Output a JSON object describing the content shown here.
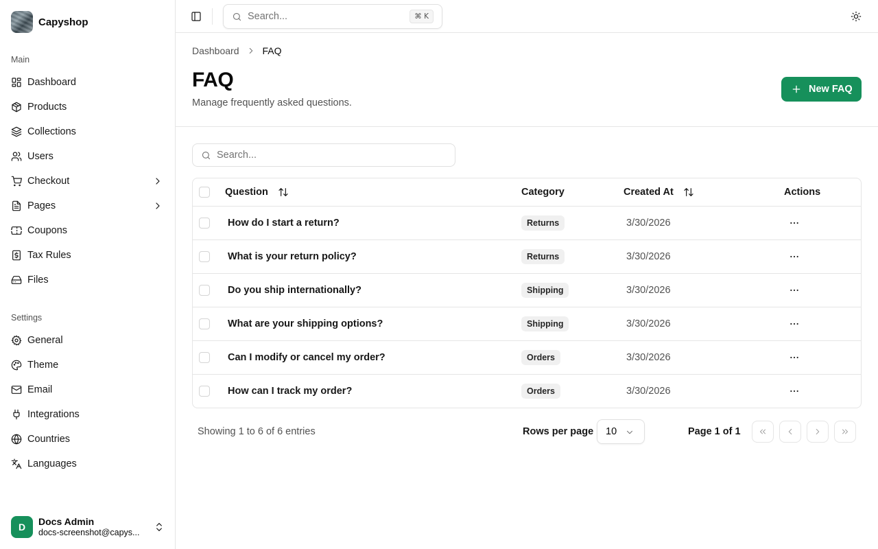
{
  "app": {
    "name": "Capyshop"
  },
  "sidebar": {
    "groups": [
      {
        "label": "Main",
        "items": [
          {
            "label": "Dashboard",
            "icon": "dashboard-icon"
          },
          {
            "label": "Products",
            "icon": "package-icon"
          },
          {
            "label": "Collections",
            "icon": "layers-icon"
          },
          {
            "label": "Users",
            "icon": "users-icon"
          },
          {
            "label": "Checkout",
            "icon": "cart-icon",
            "expandable": true
          },
          {
            "label": "Pages",
            "icon": "file-icon",
            "expandable": true
          },
          {
            "label": "Coupons",
            "icon": "ticket-icon"
          },
          {
            "label": "Tax Rules",
            "icon": "receipt-icon"
          },
          {
            "label": "Files",
            "icon": "drive-icon"
          }
        ]
      },
      {
        "label": "Settings",
        "items": [
          {
            "label": "General",
            "icon": "gear-icon"
          },
          {
            "label": "Theme",
            "icon": "palette-icon"
          },
          {
            "label": "Email",
            "icon": "mail-icon"
          },
          {
            "label": "Integrations",
            "icon": "plug-icon"
          },
          {
            "label": "Countries",
            "icon": "globe-icon"
          },
          {
            "label": "Languages",
            "icon": "translate-icon"
          }
        ]
      }
    ],
    "user": {
      "initial": "D",
      "name": "Docs Admin",
      "email": "docs-screenshot@capys..."
    }
  },
  "topbar": {
    "search": {
      "placeholder": "Search...",
      "shortcut": "⌘ K"
    }
  },
  "breadcrumb": {
    "parent": "Dashboard",
    "current": "FAQ"
  },
  "page": {
    "title": "FAQ",
    "subtitle": "Manage frequently asked questions.",
    "new_button": "New FAQ"
  },
  "table": {
    "search_placeholder": "Search...",
    "columns": {
      "question": "Question",
      "category": "Category",
      "created_at": "Created At",
      "actions": "Actions"
    },
    "rows": [
      {
        "question": "How do I start a return?",
        "category": "Returns",
        "created_at": "3/30/2026"
      },
      {
        "question": "What is your return policy?",
        "category": "Returns",
        "created_at": "3/30/2026"
      },
      {
        "question": "Do you ship internationally?",
        "category": "Shipping",
        "created_at": "3/30/2026"
      },
      {
        "question": "What are your shipping options?",
        "category": "Shipping",
        "created_at": "3/30/2026"
      },
      {
        "question": "Can I modify or cancel my order?",
        "category": "Orders",
        "created_at": "3/30/2026"
      },
      {
        "question": "How can I track my order?",
        "category": "Orders",
        "created_at": "3/30/2026"
      }
    ]
  },
  "pagination": {
    "showing": "Showing 1 to 6 of 6 entries",
    "rows_per_page_label": "Rows per page",
    "rows_per_page": "10",
    "page_info": "Page 1 of 1"
  },
  "colors": {
    "accent": "#16905b",
    "border": "#e5e5e5",
    "muted_text": "#525252"
  }
}
